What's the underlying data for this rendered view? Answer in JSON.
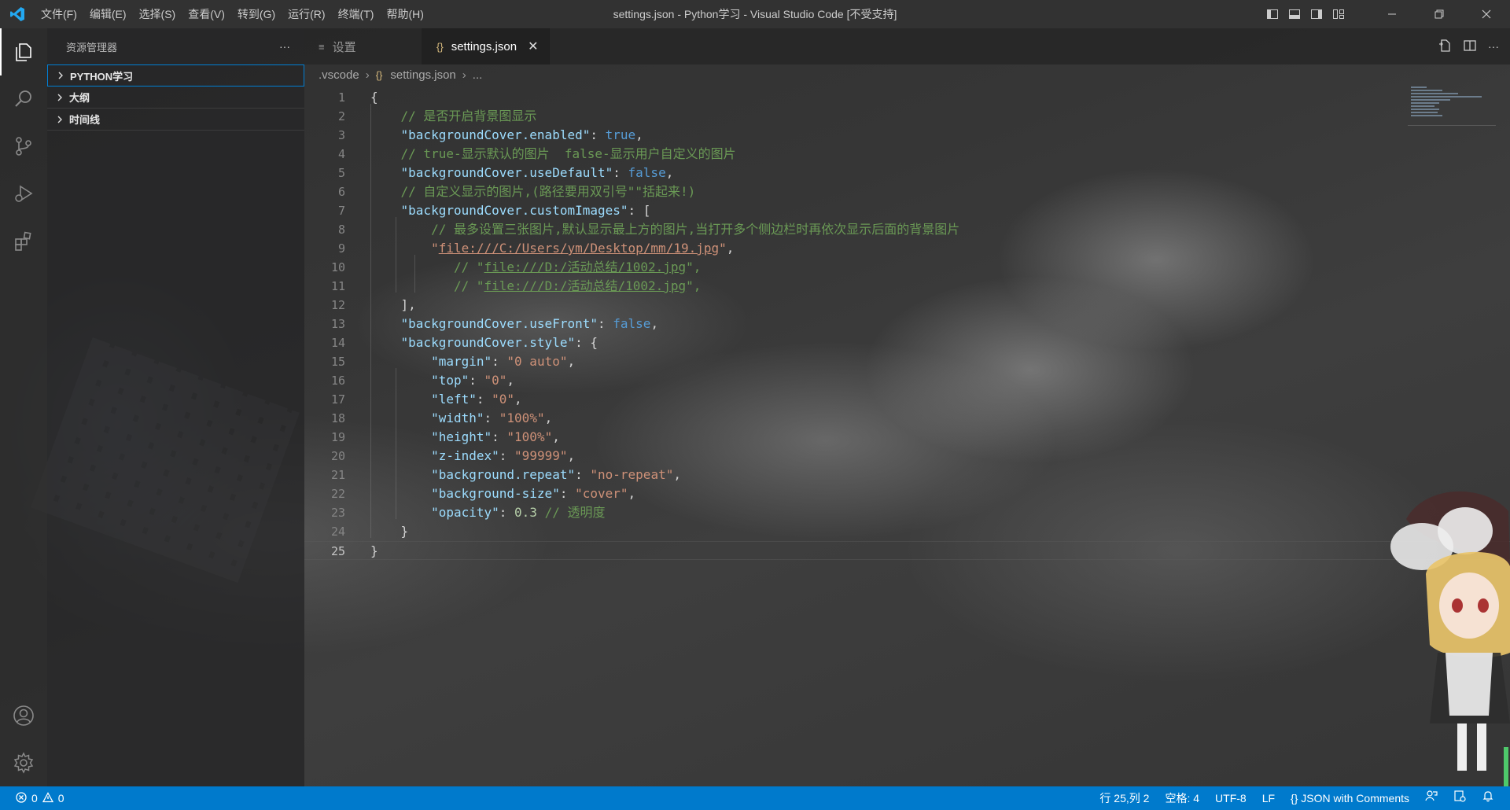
{
  "titlebar": {
    "menu": [
      "文件(F)",
      "编辑(E)",
      "选择(S)",
      "查看(V)",
      "转到(G)",
      "运行(R)",
      "终端(T)",
      "帮助(H)"
    ],
    "window_title": "settings.json - Python学习 - Visual Studio Code [不受支持]",
    "icons": [
      "vscode-logo",
      "toggle-primary-sidebar",
      "toggle-panel",
      "toggle-secondary-sidebar",
      "customize-layout",
      "minimize",
      "restore",
      "close"
    ]
  },
  "activity_bar": {
    "top": [
      "explorer-icon",
      "search-icon",
      "source-control-icon",
      "run-debug-icon",
      "extensions-icon"
    ],
    "bottom": [
      "accounts-icon",
      "manage-gear-icon"
    ]
  },
  "sidebar": {
    "title": "资源管理器",
    "more": "···",
    "sections": [
      "PYTHON学习",
      "大纲",
      "时间线"
    ]
  },
  "tabs": [
    {
      "label": "设置",
      "icon": "≡",
      "active": false
    },
    {
      "label": "settings.json",
      "icon": "{}",
      "active": true,
      "close": "✕"
    }
  ],
  "breadcrumb": {
    "folder": ".vscode",
    "icon": "{}",
    "file": "settings.json",
    "tail": "..."
  },
  "editor": {
    "current_line": 25,
    "lines": [
      "{",
      "    // 是否开启背景图显示",
      "    \"backgroundCover.enabled\": true,",
      "    // true-显示默认的图片  false-显示用户自定义的图片",
      "    \"backgroundCover.useDefault\": false,",
      "    // 自定义显示的图片,(路径要用双引号\"\"括起来!)",
      "    \"backgroundCover.customImages\": [",
      "        // 最多设置三张图片,默认显示最上方的图片,当打开多个侧边栏时再依次显示后面的背景图片",
      "        \"file:///C:/Users/ym/Desktop/mm/19.jpg\",",
      "           // \"file:///D:/活动总结/1002.jpg\",",
      "           // \"file:///D:/活动总结/1002.jpg\",",
      "    ],",
      "    \"backgroundCover.useFront\": false,",
      "    \"backgroundCover.style\": {",
      "        \"margin\": \"0 auto\",",
      "        \"top\": \"0\",",
      "        \"left\": \"0\",",
      "        \"width\": \"100%\",",
      "        \"height\": \"100%\",",
      "        \"z-index\": \"99999\",",
      "        \"background.repeat\": \"no-repeat\",",
      "        \"background-size\": \"cover\",",
      "        \"opacity\": 0.3 // 透明度",
      "    }",
      "}"
    ]
  },
  "statusbar": {
    "errors": "0",
    "warnings": "0",
    "position": "行 25,列 2",
    "indent": "空格: 4",
    "encoding": "UTF-8",
    "eol": "LF",
    "language_icon": "{}",
    "language": "JSON with Comments"
  },
  "colors": {
    "accent": "#007acc",
    "string": "#ce9178",
    "key": "#9cdcfe",
    "comment": "#6a9955",
    "keyword": "#569cd6",
    "number": "#b5cea8"
  }
}
